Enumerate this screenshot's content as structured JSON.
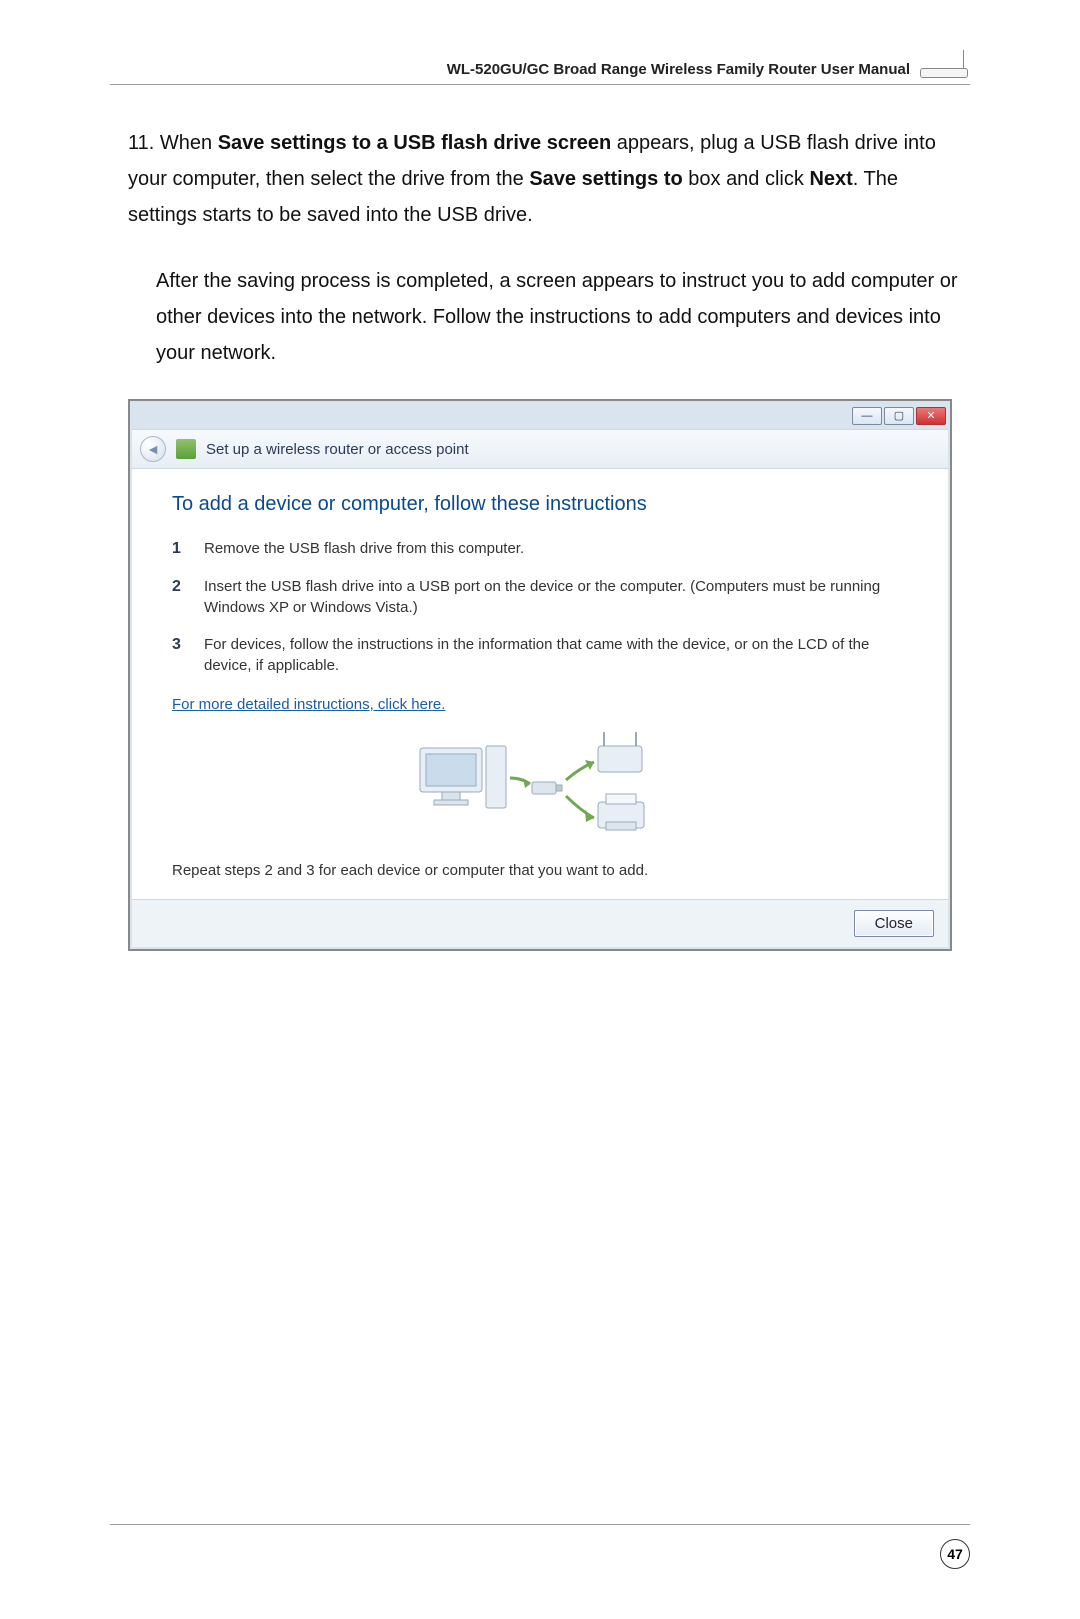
{
  "header": {
    "title": "WL-520GU/GC Broad Range Wireless Family Router User Manual"
  },
  "step": {
    "number": "11.",
    "text_prefix": "When ",
    "bold1": "Save settings to a USB flash drive screen",
    "text_mid1": " appears, plug a USB flash drive into your computer, then select the drive from the ",
    "bold2": "Save settings to",
    "text_mid2": " box and click ",
    "bold3": "Next",
    "text_suffix": ". The settings starts to be saved into the USB drive."
  },
  "para2": "After the saving process is completed, a screen appears to instruct you to add computer or other devices into the network. Follow the instructions to add computers and devices into your network.",
  "dialog": {
    "toolbar_title": "Set up a wireless router or access point",
    "heading": "To add a device or computer, follow these instructions",
    "steps": [
      {
        "n": "1",
        "text": "Remove the USB flash drive from this computer."
      },
      {
        "n": "2",
        "text": "Insert the USB flash drive into a USB port on the device or the computer. (Computers must be running Windows XP or Windows Vista.)"
      },
      {
        "n": "3",
        "text": "For devices, follow the instructions in the information that came with the device, or on the LCD of the device, if applicable."
      }
    ],
    "link": "For more detailed instructions, click here.",
    "repeat": "Repeat steps 2 and 3 for each device or computer that you want to add.",
    "close": "Close",
    "win_min": "—",
    "win_max": "▢",
    "win_close": "✕"
  },
  "page_number": "47"
}
